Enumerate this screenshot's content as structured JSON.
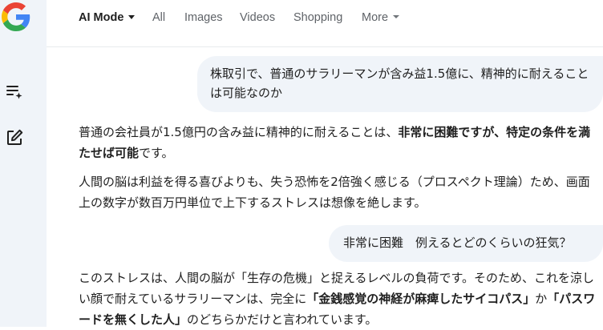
{
  "nav": {
    "tabs": [
      {
        "label": "AI Mode",
        "active": true
      },
      {
        "label": "All"
      },
      {
        "label": "Images"
      },
      {
        "label": "Videos"
      },
      {
        "label": "Shopping"
      },
      {
        "label": "More"
      }
    ]
  },
  "sidebar": {
    "icons": [
      "google-logo",
      "new-thread-icon",
      "edit-icon"
    ]
  },
  "conversation": {
    "q1": "株取引で、普通のサラリーマンが含み益1.5億に、精神的に耐えることは可能なのか",
    "a1": {
      "p1_pre": "普通の会社員が1.5億円の含み益に精神的に耐えることは、",
      "p1_bold": "非常に困難ですが、特定の条件を満たせば可能",
      "p1_post": "です。",
      "p2": "人間の脳は利益を得る喜びよりも、失う恐怖を2倍強く感じる（プロスペクト理論）ため、画面上の数字が数百万円単位で上下するストレスは想像を絶します。"
    },
    "q2": "非常に困難　例えるとどのくらいの狂気？",
    "a2": {
      "pre": "このストレスは、人間の脳が「生存の危機」と捉えるレベルの負荷です。そのため、これを涼しい顔で耐えているサラリーマンは、完全に",
      "bold1": "「金銭感覚の神経が麻痺したサイコパス」",
      "mid": "か",
      "bold2": "「パスワードを無くした人」",
      "post": "のどちらかだけと言われています。"
    }
  },
  "colors": {
    "sidebar_bg": "#f0f4f9",
    "bubble_bg": "#f0f4f9",
    "text": "#1f1f1f",
    "nav_text": "#5f6368"
  }
}
